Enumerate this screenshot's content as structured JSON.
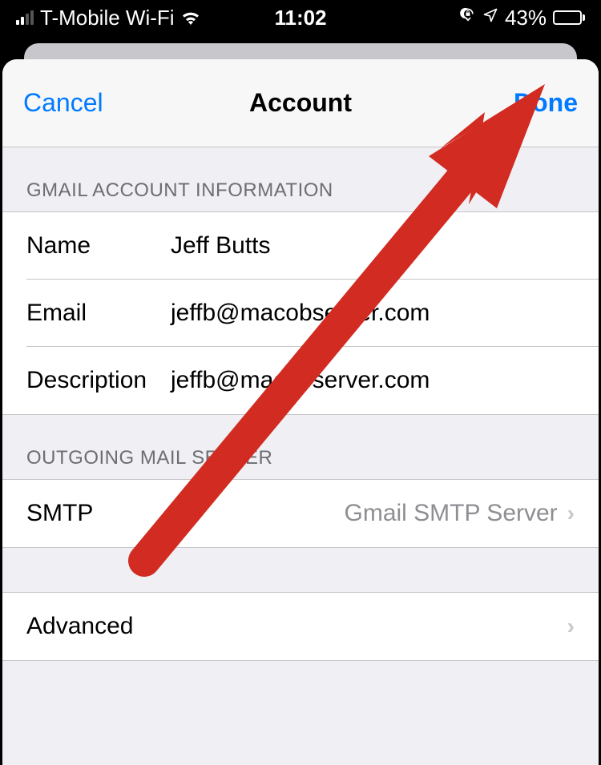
{
  "status": {
    "carrier": "T-Mobile Wi-Fi",
    "time": "11:02",
    "battery_pct": "43%"
  },
  "nav": {
    "cancel": "Cancel",
    "title": "Account",
    "done": "Done"
  },
  "sections": {
    "account_info_header": "GMAIL ACCOUNT INFORMATION",
    "outgoing_header": "OUTGOING MAIL SERVER"
  },
  "fields": {
    "name_label": "Name",
    "name_value": "Jeff Butts",
    "email_label": "Email",
    "email_value": "jeffb@macobserver.com",
    "description_label": "Description",
    "description_value": "jeffb@macobserver.com",
    "smtp_label": "SMTP",
    "smtp_value": "Gmail SMTP Server",
    "advanced_label": "Advanced"
  },
  "colors": {
    "accent": "#007aff",
    "arrow": "#d22b21"
  }
}
